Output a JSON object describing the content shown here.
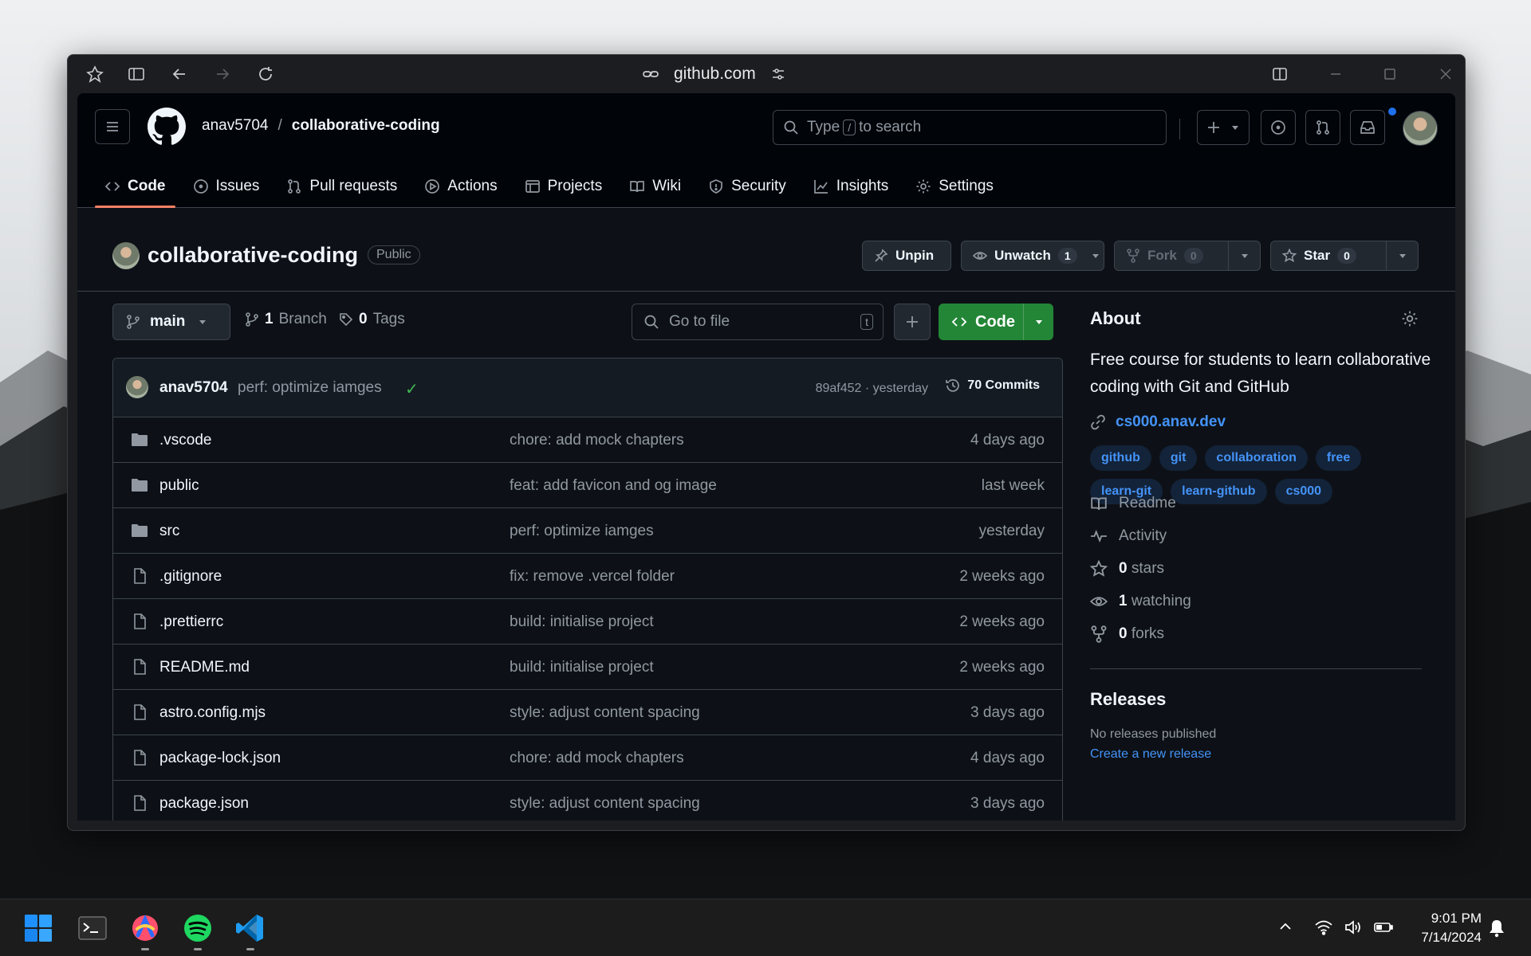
{
  "browser": {
    "url": "github.com"
  },
  "header": {
    "owner": "anav5704",
    "separator": "/",
    "repo": "collaborative-coding",
    "search_prefix": "Type",
    "search_key": "/",
    "search_suffix": "to search"
  },
  "tabs": [
    {
      "label": "Code",
      "icon": "code-icon",
      "active": true
    },
    {
      "label": "Issues",
      "icon": "issue-icon"
    },
    {
      "label": "Pull requests",
      "icon": "pull-request-icon"
    },
    {
      "label": "Actions",
      "icon": "play-icon"
    },
    {
      "label": "Projects",
      "icon": "table-icon"
    },
    {
      "label": "Wiki",
      "icon": "book-icon"
    },
    {
      "label": "Security",
      "icon": "shield-icon"
    },
    {
      "label": "Insights",
      "icon": "graph-icon"
    },
    {
      "label": "Settings",
      "icon": "gear-icon"
    }
  ],
  "repo": {
    "title": "collaborative-coding",
    "visibility": "Public",
    "unpin": "Unpin",
    "unwatch": "Unwatch",
    "watch_count": "1",
    "fork": "Fork",
    "fork_count": "0",
    "star": "Star",
    "star_count": "0"
  },
  "toolbar": {
    "branch": "main",
    "branch_count": "1",
    "branch_label": "Branch",
    "tag_count": "0",
    "tag_label": "Tags",
    "goto_placeholder": "Go to file",
    "goto_key": "t",
    "code_button": "Code"
  },
  "last_commit": {
    "author": "anav5704",
    "message": "perf: optimize iamges",
    "hash_time": "89af452 · yesterday",
    "commits": "70 Commits"
  },
  "files": [
    {
      "type": "folder",
      "name": ".vscode",
      "message": "chore: add mock chapters",
      "time": "4 days ago"
    },
    {
      "type": "folder",
      "name": "public",
      "message": "feat: add favicon and og image",
      "time": "last week"
    },
    {
      "type": "folder",
      "name": "src",
      "message": "perf: optimize iamges",
      "time": "yesterday"
    },
    {
      "type": "file",
      "name": ".gitignore",
      "message": "fix: remove .vercel folder",
      "time": "2 weeks ago"
    },
    {
      "type": "file",
      "name": ".prettierrc",
      "message": "build: initialise project",
      "time": "2 weeks ago"
    },
    {
      "type": "file",
      "name": "README.md",
      "message": "build: initialise project",
      "time": "2 weeks ago"
    },
    {
      "type": "file",
      "name": "astro.config.mjs",
      "message": "style: adjust content spacing",
      "time": "3 days ago"
    },
    {
      "type": "file",
      "name": "package-lock.json",
      "message": "chore: add mock chapters",
      "time": "4 days ago"
    },
    {
      "type": "file",
      "name": "package.json",
      "message": "style: adjust content spacing",
      "time": "3 days ago"
    }
  ],
  "about": {
    "title": "About",
    "description": "Free course for students to learn collaborative coding with Git and GitHub",
    "website": "cs000.anav.dev",
    "topics": [
      "github",
      "git",
      "collaboration",
      "free",
      "learn-git",
      "learn-github",
      "cs000"
    ],
    "readme": "Readme",
    "activity": "Activity",
    "stars_count": "0",
    "stars_label": "stars",
    "watching_count": "1",
    "watching_label": "watching",
    "forks_count": "0",
    "forks_label": "forks"
  },
  "releases": {
    "title": "Releases",
    "empty": "No releases published",
    "create": "Create a new release"
  },
  "taskbar": {
    "time": "9:01 PM",
    "date": "7/14/2024"
  },
  "colors": {
    "accent_blue": "#4493f8",
    "primary_green": "#238636",
    "tab_underline": "#f78166",
    "bg": "#0d1117"
  }
}
